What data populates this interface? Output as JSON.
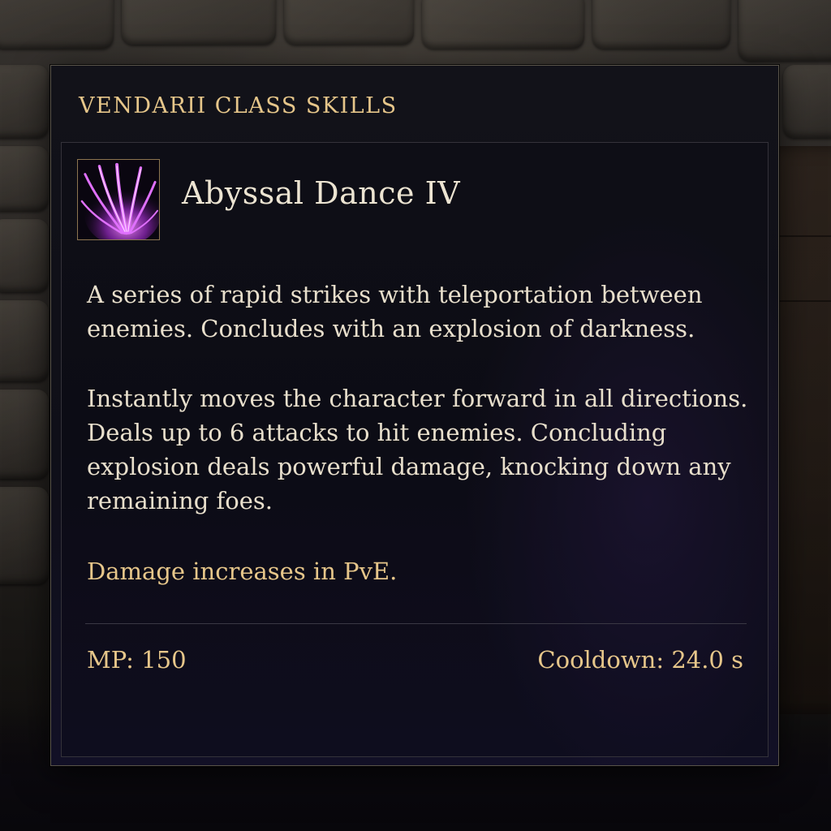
{
  "panel": {
    "title": "VENDARII CLASS SKILLS"
  },
  "skill": {
    "name": "Abyssal Dance IV",
    "icon": "purple-claw-strike-icon",
    "description": [
      "A series of rapid strikes with teleportation between enemies. Concludes with an explosion of darkness.",
      "Instantly moves the character forward in all directions. Deals up to 6 attacks to hit enemies. Concluding explosion deals powerful damage, knocking down any remaining foes.",
      "Damage increases in PvE."
    ],
    "mp_cost": "MP: 150",
    "cooldown": "Cooldown: 24.0 s"
  },
  "colors": {
    "title_gold": "#e6c68a",
    "body_text": "#e8dfcc",
    "panel_bg": "#121219",
    "icon_purple": "#d24cff"
  }
}
